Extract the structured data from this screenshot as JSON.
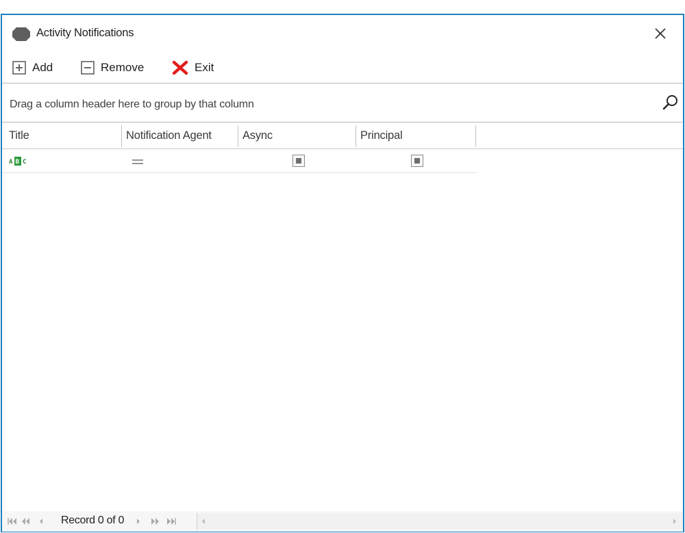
{
  "window": {
    "title": "Activity Notifications",
    "icon": "octagon-icon",
    "close_icon": "close-icon"
  },
  "toolbar": {
    "add_label": "Add",
    "remove_label": "Remove",
    "exit_label": "Exit"
  },
  "grid": {
    "group_panel_text": "Drag a column header here to group by that column",
    "columns": [
      "Title",
      "Notification Agent",
      "Async",
      "Principal"
    ],
    "new_row": {
      "title_icon": "abc-text-icon",
      "agent_icon": "equals-icon",
      "async_checked": "indeterminate",
      "principal_checked": "indeterminate"
    }
  },
  "navigator": {
    "record_text": "Record 0 of 0"
  },
  "colors": {
    "window_border": "#1b7fc0",
    "exit_icon": "#e21d1d",
    "abc_icon": "#2e9b3a"
  }
}
